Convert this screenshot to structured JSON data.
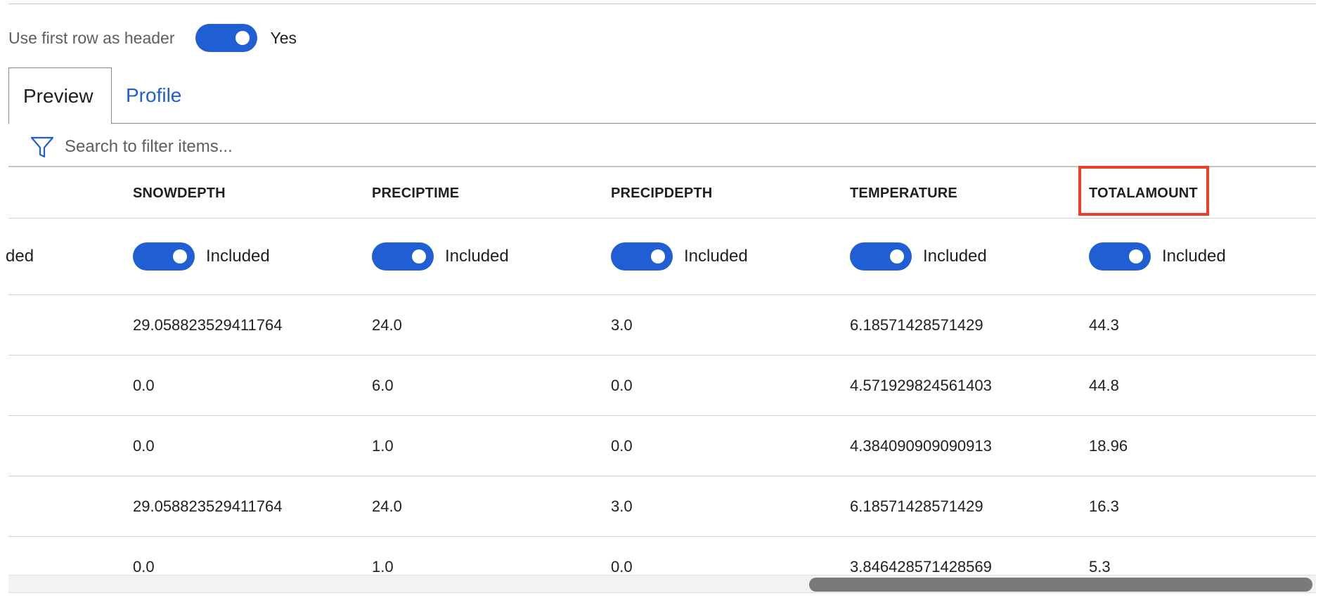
{
  "header_toggle": {
    "label": "Use first row as header",
    "state_text": "Yes",
    "on": true
  },
  "tabs": [
    {
      "label": "Preview",
      "active": true
    },
    {
      "label": "Profile",
      "active": false
    }
  ],
  "search": {
    "icon": "filter-icon",
    "placeholder": "Search to filter items..."
  },
  "table": {
    "partial_column_toggle_text": "ded",
    "columns": [
      {
        "name": "SNOWDEPTH",
        "status": "Included"
      },
      {
        "name": "PRECIPTIME",
        "status": "Included"
      },
      {
        "name": "PRECIPDEPTH",
        "status": "Included"
      },
      {
        "name": "TEMPERATURE",
        "status": "Included"
      },
      {
        "name": "TOTALAMOUNT",
        "status": "Included",
        "highlighted": true
      }
    ],
    "rows": [
      [
        "29.058823529411764",
        "24.0",
        "3.0",
        "6.18571428571429",
        "44.3"
      ],
      [
        "0.0",
        "6.0",
        "0.0",
        "4.571929824561403",
        "44.8"
      ],
      [
        "0.0",
        "1.0",
        "0.0",
        "4.384090909090913",
        "18.96"
      ],
      [
        "29.058823529411764",
        "24.0",
        "3.0",
        "6.18571428571429",
        "16.3"
      ],
      [
        "0.0",
        "1.0",
        "0.0",
        "3.846428571428569",
        "5.3"
      ]
    ]
  },
  "colors": {
    "accent": "#1f5fd3",
    "highlight": "#e8402a"
  }
}
